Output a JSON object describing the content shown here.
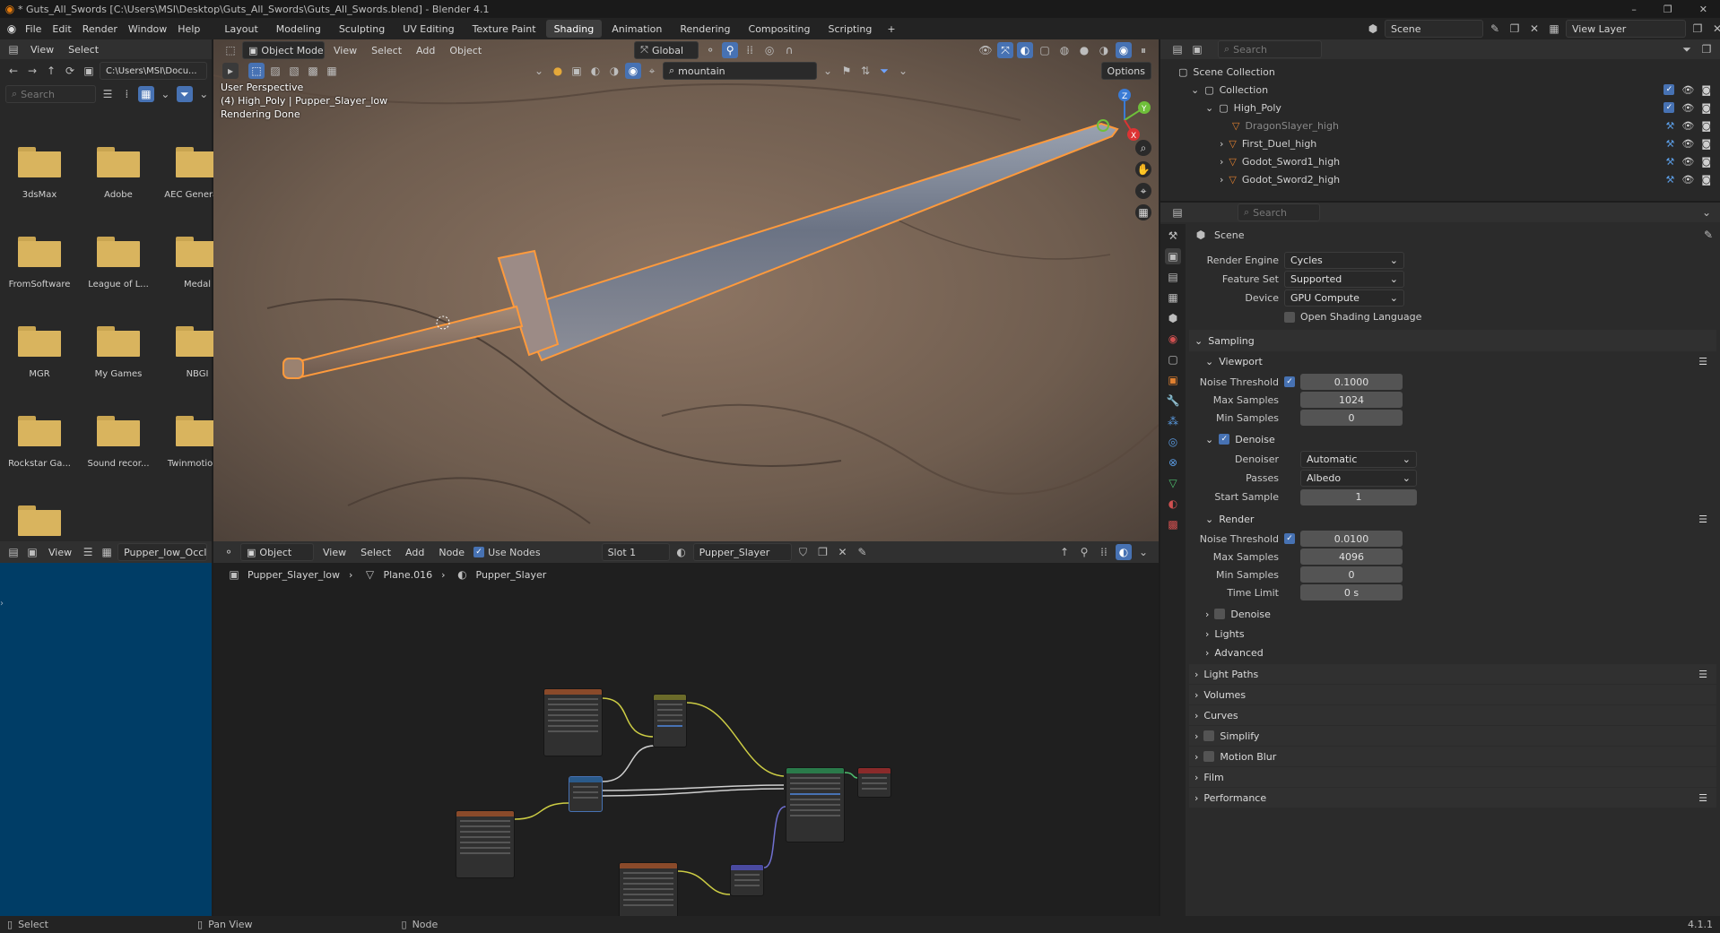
{
  "window": {
    "title": "* Guts_All_Swords [C:\\Users\\MSI\\Desktop\\Guts_All_Swords\\Guts_All_Swords.blend] - Blender 4.1",
    "controls": {
      "minimize": "–",
      "maximize": "❐",
      "close": "✕"
    }
  },
  "menu": [
    "File",
    "Edit",
    "Render",
    "Window",
    "Help"
  ],
  "workspaces": [
    "Layout",
    "Modeling",
    "Sculpting",
    "UV Editing",
    "Texture Paint",
    "Shading",
    "Animation",
    "Rendering",
    "Compositing",
    "Scripting"
  ],
  "active_workspace": "Shading",
  "add_tab": "+",
  "scene_label": "Scene",
  "view_layer_label": "View Layer",
  "file_browser": {
    "menus": [
      "View",
      "Select"
    ],
    "path": "C:\\Users\\MSI\\Docu...",
    "search_placeholder": "Search",
    "folders": [
      "3dsMax",
      "Adobe",
      "AEC Generat...",
      "FromSoftware",
      "League of L...",
      "Medal",
      "MGR",
      "My Games",
      "NBGI",
      "Rockstar Ga...",
      "Sound recor...",
      "Twinmotion...",
      ""
    ]
  },
  "viewport": {
    "mode": "Object Mode",
    "menus": [
      "View",
      "Select",
      "Add",
      "Object"
    ],
    "orientation": "Global",
    "hdri_search": "mountain",
    "options_label": "Options",
    "overlay_lines": [
      "User Perspective",
      "(4) High_Poly | Pupper_Slayer_low",
      "Rendering Done"
    ],
    "gizmo": {
      "x": "X",
      "y": "Y",
      "z": "Z"
    }
  },
  "image_editor": {
    "view_label": "View",
    "image_name": "Pupper_low_Occlus"
  },
  "node_editor": {
    "type_label": "Object",
    "menus": [
      "View",
      "Select",
      "Add",
      "Node"
    ],
    "use_nodes_label": "Use Nodes",
    "slot": "Slot 1",
    "material": "Pupper_Slayer",
    "breadcrumb": [
      "Pupper_Slayer_low",
      "Plane.016",
      "Pupper_Slayer"
    ]
  },
  "outliner": {
    "search_placeholder": "Search",
    "root": "Scene Collection",
    "items": [
      {
        "name": "Collection",
        "level": 1
      },
      {
        "name": "High_Poly",
        "level": 2
      },
      {
        "name": "DragonSlayer_high",
        "level": 3
      },
      {
        "name": "First_Duel_high",
        "level": 3
      },
      {
        "name": "Godot_Sword1_high",
        "level": 3
      },
      {
        "name": "Godot_Sword2_high",
        "level": 3
      }
    ]
  },
  "properties": {
    "search_placeholder": "Search",
    "context": "Scene",
    "render_engine": {
      "label": "Render Engine",
      "value": "Cycles"
    },
    "feature_set": {
      "label": "Feature Set",
      "value": "Supported"
    },
    "device": {
      "label": "Device",
      "value": "GPU Compute"
    },
    "osl_label": "Open Shading Language",
    "sampling_label": "Sampling",
    "viewport_label": "Viewport",
    "viewport": {
      "noise_threshold_label": "Noise Threshold",
      "noise_threshold": "0.1000",
      "max_samples_label": "Max Samples",
      "max_samples": "1024",
      "min_samples_label": "Min Samples",
      "min_samples": "0"
    },
    "denoise_label": "Denoise",
    "denoise": {
      "denoiser_label": "Denoiser",
      "denoiser": "Automatic",
      "passes_label": "Passes",
      "passes": "Albedo",
      "start_sample_label": "Start Sample",
      "start_sample": "1"
    },
    "render_label": "Render",
    "render": {
      "noise_threshold_label": "Noise Threshold",
      "noise_threshold": "0.0100",
      "max_samples_label": "Max Samples",
      "max_samples": "4096",
      "min_samples_label": "Min Samples",
      "min_samples": "0",
      "time_limit_label": "Time Limit",
      "time_limit": "0 s"
    },
    "render_denoise_label": "Denoise",
    "lights_label": "Lights",
    "advanced_label": "Advanced",
    "panels": [
      "Light Paths",
      "Volumes",
      "Curves",
      "Simplify",
      "Motion Blur",
      "Film",
      "Performance"
    ]
  },
  "status_bar": {
    "select": "Select",
    "pan": "Pan View",
    "node": "Node",
    "version": "4.1.1"
  }
}
